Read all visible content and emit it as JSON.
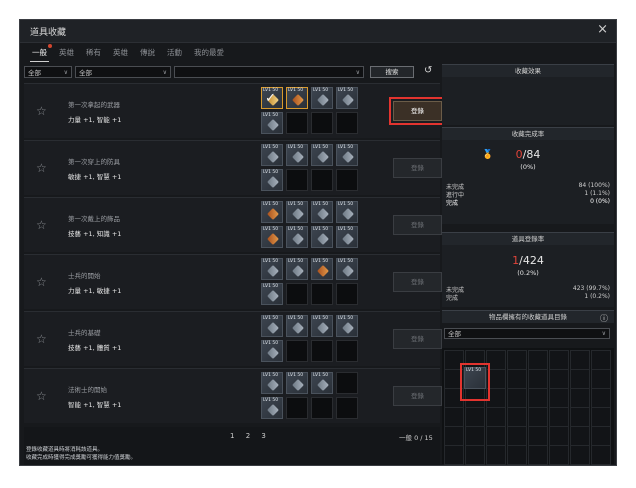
{
  "window": {
    "title": "道具收藏",
    "close_label": "×"
  },
  "tabs": [
    {
      "label": "一般",
      "active": true
    },
    {
      "label": "英雄"
    },
    {
      "label": "稀有"
    },
    {
      "label": "英雄"
    },
    {
      "label": "傳說"
    },
    {
      "label": "活動"
    },
    {
      "label": "我的最愛"
    }
  ],
  "filters": {
    "grade": "全部",
    "category": "全部",
    "search_value": "",
    "search_button": "搜索",
    "refresh_icon": "refresh-icon"
  },
  "rows": [
    {
      "name": "第一次拿起的武器",
      "stats": "力量 +1, 智能 +1",
      "register": "登錄",
      "active": true
    },
    {
      "name": "第一次穿上的防具",
      "stats": "敏捷 +1, 智慧 +1",
      "register": "登錄"
    },
    {
      "name": "第一次戴上的飾品",
      "stats": "技藝 +1, 知識 +1",
      "register": "登錄"
    },
    {
      "name": "士兵的開始",
      "stats": "力量 +1, 敏捷 +1",
      "register": "登錄"
    },
    {
      "name": "士兵的基礎",
      "stats": "技藝 +1, 體質 +1",
      "register": "登錄"
    },
    {
      "name": "法術士的開始",
      "stats": "智能 +1, 智慧 +1",
      "register": "登錄"
    }
  ],
  "slot_label": "LV1 50",
  "footer": {
    "pages": [
      "1",
      "2",
      "3"
    ],
    "count": "一般 0 / 15",
    "info_line1": "登錄收藏道具時將消耗該道具。",
    "info_line2": "收藏完成時獲得完成獎勵可獲得能力值獎勵。"
  },
  "side": {
    "effect_title": "收藏效果",
    "completion_title": "收藏完成率",
    "completion_value": "0",
    "completion_total": "/84",
    "completion_pct": "(0%)",
    "completion_rows": [
      {
        "label": "未完成",
        "value": "84 (100%)"
      },
      {
        "label": "進行中",
        "value": "1 (1.1%)"
      },
      {
        "label": "完成",
        "value": "0 (0%)"
      }
    ],
    "register_title": "道具登錄率",
    "register_value": "1",
    "register_total": "/424",
    "register_pct": "(0.2%)",
    "register_rows": [
      {
        "label": "未完成",
        "value": "423 (99.7%)"
      },
      {
        "label": "完成",
        "value": "1 (0.2%)"
      }
    ],
    "inventory_title": "物品欄擁有的收藏道具目錄",
    "inventory_filter": "全部"
  }
}
